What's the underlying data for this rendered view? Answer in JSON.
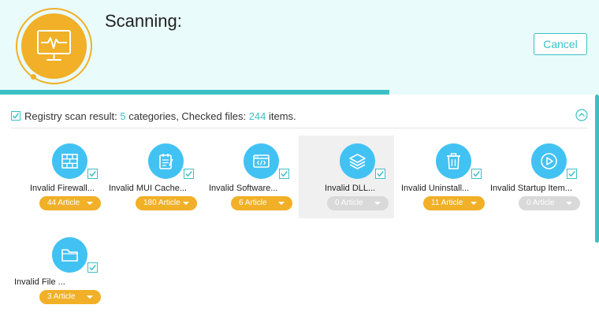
{
  "header": {
    "title": "Scanning:",
    "cancel_label": "Cancel",
    "logo_icon": "monitor-pulse-icon",
    "progress_fraction": 0.65
  },
  "summary": {
    "prefix": "Registry scan result: ",
    "categories_count": "5",
    "middle": " categories, Checked files: ",
    "files_count": "244",
    "suffix": " items."
  },
  "colors": {
    "accent": "#3cc0c6",
    "brand_orange": "#f1b027",
    "icon_blue": "#42c2f3",
    "disabled": "#d9d9d9"
  },
  "categories": [
    {
      "label": "Invalid Firewall...",
      "count": "44 Article",
      "icon": "firewall-icon",
      "enabled": true,
      "selected": false
    },
    {
      "label": "Invalid MUI Cache...",
      "count": "180 Article",
      "icon": "notepad-icon",
      "enabled": true,
      "selected": false
    },
    {
      "label": "Invalid Software...",
      "count": "6 Article",
      "icon": "software-code-icon",
      "enabled": true,
      "selected": false
    },
    {
      "label": "Invalid DLL...",
      "count": "0 Article",
      "icon": "layers-icon",
      "enabled": false,
      "selected": true
    },
    {
      "label": "Invalid Uninstall...",
      "count": "11 Article",
      "icon": "trash-icon",
      "enabled": true,
      "selected": false
    },
    {
      "label": "Invalid Startup Item...",
      "count": "0 Article",
      "icon": "play-circle-icon",
      "enabled": false,
      "selected": false
    },
    {
      "label": "Invalid File ...",
      "count": "3 Article",
      "icon": "folder-icon",
      "enabled": true,
      "selected": false
    }
  ]
}
